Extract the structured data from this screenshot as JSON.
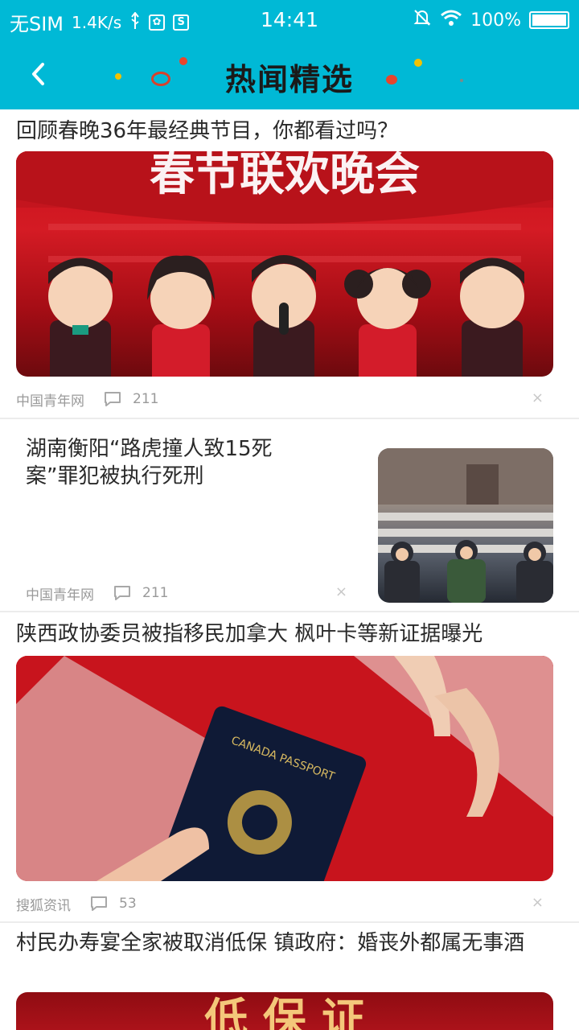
{
  "status_bar": {
    "carrier": "无SIM",
    "speed": "1.4K/s",
    "time": "14:41",
    "battery": "100%",
    "icons": [
      "usb-icon",
      "app-icon",
      "s-icon",
      "mute-icon",
      "wifi-icon",
      "battery-icon"
    ]
  },
  "header": {
    "title": "热闻精选",
    "back_icon": "back-chevron-icon",
    "colors": {
      "bar": "#00b9d6",
      "title": "#1a1a1a"
    }
  },
  "articles": [
    {
      "title": "回顾春晚36年最经典节目，你都看过吗？",
      "layout": "large-image",
      "image_text": "春节联欢晚会",
      "source": "中国青年网",
      "comments": "211",
      "dismiss": "×"
    },
    {
      "title": "湖南衡阳“路虎撞人致15死案”罪犯被执行死刑",
      "layout": "right-thumbnail",
      "source": "中国青年网",
      "comments": "211",
      "dismiss": "×"
    },
    {
      "title": "陕西政协委员被指移民加拿大 枫叶卡等新证据曝光",
      "layout": "large-image",
      "image_text": "CANADA PASSPORT",
      "source": "搜狐资讯",
      "comments": "53",
      "dismiss": "×"
    },
    {
      "title": "村民办寿宴全家被取消低保 镇政府：婚丧外都属无事酒",
      "layout": "large-image",
      "image_text": "低 保 证"
    }
  ]
}
